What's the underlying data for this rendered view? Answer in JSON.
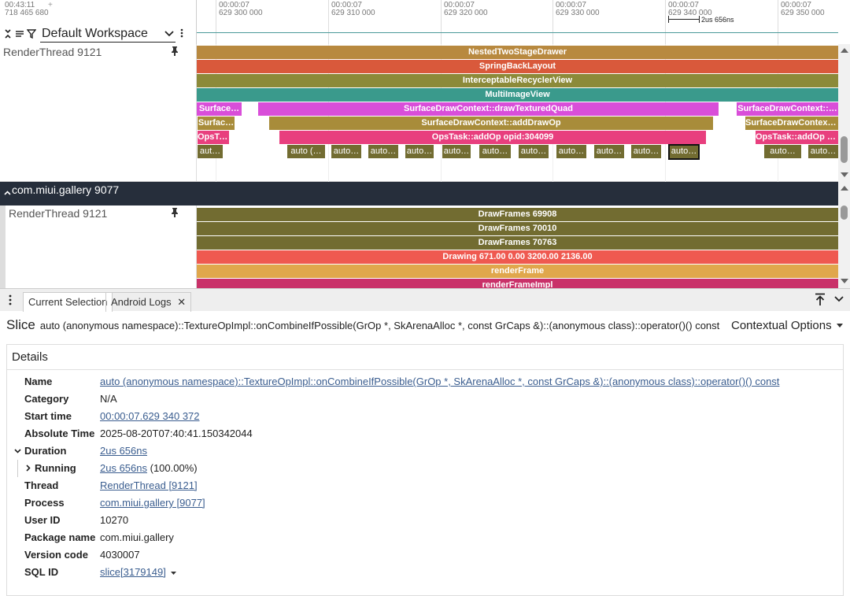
{
  "ruler": {
    "time_top": "00:43:11",
    "time_bottom": "718 465 680",
    "plus": "+",
    "ticks": [
      {
        "top": "00:00:07",
        "bottom": "629 300 000"
      },
      {
        "top": "00:00:07",
        "bottom": "629 310 000"
      },
      {
        "top": "00:00:07",
        "bottom": "629 320 000"
      },
      {
        "top": "00:00:07",
        "bottom": "629 330 000"
      },
      {
        "top": "00:00:07",
        "bottom": "629 340 000"
      },
      {
        "top": "00:00:07",
        "bottom": "629 350 000"
      }
    ],
    "measure_label": "2us 656ns"
  },
  "toolbar": {
    "workspace": "Default Workspace"
  },
  "tracks": {
    "render_thread_top_label": "RenderThread 9121",
    "group_label": "com.miui.gallery 9077",
    "render_thread_bottom_label": "RenderThread 9121"
  },
  "slices_top": [
    {
      "label": "NestedTwoStageDrawer",
      "color": "#b8893f"
    },
    {
      "label": "SpringBackLayout",
      "color": "#d9593b"
    },
    {
      "label": "InterceptableRecyclerView",
      "color": "#8c8a39"
    },
    {
      "label": "MultiImageView",
      "color": "#3a9a8c"
    },
    {
      "label": "Surface…",
      "color": "#d94ed9"
    },
    {
      "label": "SurfaceDrawContext::drawTexturedQuad",
      "color": "#d94ed9"
    },
    {
      "label": "SurfaceDrawContext::…",
      "color": "#d94ed9"
    },
    {
      "label": "Surfac…",
      "color": "#a88c3a"
    },
    {
      "label": "SurfaceDrawContext::addDrawOp",
      "color": "#a88c3a"
    },
    {
      "label": "SurfaceDrawContext…",
      "color": "#a88c3a"
    },
    {
      "label": "OpsTa…",
      "color": "#e83f7e"
    },
    {
      "label": "OpsTask::addOp opid:304099",
      "color": "#e83f7e"
    },
    {
      "label": "OpsTask::addOp o…",
      "color": "#e83f7e"
    }
  ],
  "auto_slices": [
    "aut…",
    "auto (…",
    "auto…",
    "auto…",
    "auto…",
    "auto…",
    "auto…",
    "auto…",
    "auto…",
    "auto…",
    "auto…",
    "auto…",
    "auto…",
    "auto…"
  ],
  "slices_bottom": [
    {
      "label": "DrawFrames 69908",
      "color": "#726c31"
    },
    {
      "label": "DrawFrames 70010",
      "color": "#726c31"
    },
    {
      "label": "DrawFrames 70763",
      "color": "#726c31"
    },
    {
      "label": "Drawing 671.00  0.00 3200.00 2136.00",
      "color": "#ef5950"
    },
    {
      "label": "renderFrame",
      "color": "#e0a74c"
    },
    {
      "label": "renderFrameImpl",
      "color": "#c93169"
    }
  ],
  "tabs": {
    "current_selection": "Current Selection",
    "android_logs": "Android Logs"
  },
  "selection": {
    "kind": "Slice",
    "title": "auto (anonymous namespace)::TextureOpImpl::onCombineIfPossible(GrOp *, SkArenaAlloc *, const GrCaps &)::(anonymous class)::operator()() const",
    "contextual": "Contextual Options"
  },
  "details": {
    "heading": "Details",
    "rows": [
      {
        "key": "Name",
        "value": "auto (anonymous namespace)::TextureOpImpl::onCombineIfPossible(GrOp *, SkArenaAlloc *, const GrCaps &)::(anonymous class)::operator()() const"
      },
      {
        "key": "Category",
        "value": "N/A"
      },
      {
        "key": "Start time",
        "value": "00:00:07.629 340 372"
      },
      {
        "key": "Absolute Time",
        "value": "2025-08-20T07:40:41.150342044"
      },
      {
        "key": "Duration",
        "value": "2us 656ns"
      },
      {
        "key": "Running",
        "value": "2us 656ns",
        "extra": " (100.00%)"
      },
      {
        "key": "Thread",
        "value": "RenderThread [9121]"
      },
      {
        "key": "Process",
        "value": "com.miui.gallery [9077]"
      },
      {
        "key": "User ID",
        "value": "10270"
      },
      {
        "key": "Package name",
        "value": "com.miui.gallery"
      },
      {
        "key": "Version code",
        "value": "4030007"
      },
      {
        "key": "SQL ID",
        "value": "slice[3179149]"
      }
    ]
  }
}
